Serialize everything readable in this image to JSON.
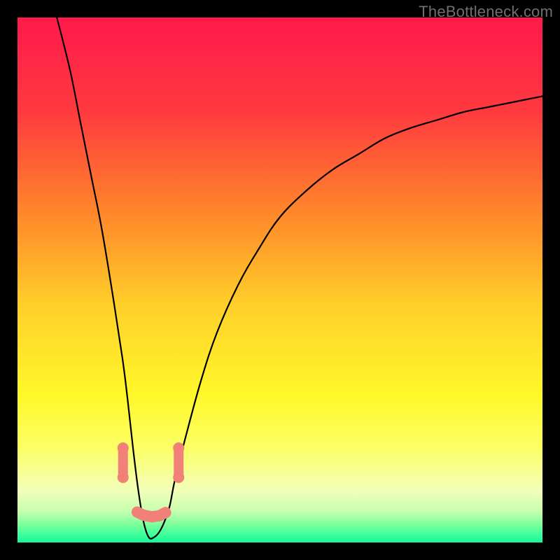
{
  "watermark": "TheBottleneck.com",
  "chart_data": {
    "type": "line",
    "title": "",
    "xlabel": "",
    "ylabel": "",
    "xlim": [
      0,
      100
    ],
    "ylim": [
      0,
      100
    ],
    "grid": false,
    "legend": false,
    "optimum_x": 25,
    "background_gradient": {
      "stops": [
        {
          "offset": 0.0,
          "color": "#ff1a4b"
        },
        {
          "offset": 0.18,
          "color": "#ff3a3f"
        },
        {
          "offset": 0.38,
          "color": "#ff8a2a"
        },
        {
          "offset": 0.55,
          "color": "#ffd02a"
        },
        {
          "offset": 0.72,
          "color": "#fff82a"
        },
        {
          "offset": 0.82,
          "color": "#fcff66"
        },
        {
          "offset": 0.9,
          "color": "#f2ffb8"
        },
        {
          "offset": 0.94,
          "color": "#c8ffb0"
        },
        {
          "offset": 0.965,
          "color": "#7fff9c"
        },
        {
          "offset": 0.985,
          "color": "#3dff9c"
        },
        {
          "offset": 1.0,
          "color": "#18f59c"
        }
      ]
    },
    "series": [
      {
        "name": "bottleneck-curve",
        "color": "#000000",
        "x": [
          7.5,
          10,
          12,
          14,
          16,
          18,
          20,
          21,
          22,
          23,
          24,
          25,
          26,
          27,
          28,
          29,
          30,
          32,
          35,
          38,
          42,
          46,
          50,
          55,
          60,
          65,
          70,
          75,
          80,
          85,
          90,
          95,
          100
        ],
        "values": [
          100,
          90,
          80,
          70,
          60,
          48,
          35,
          27,
          18,
          10,
          4,
          1,
          1,
          2,
          4,
          7,
          12,
          20,
          31,
          40,
          49,
          56,
          62,
          67,
          71,
          74,
          77,
          79,
          80.5,
          82,
          83,
          84,
          85
        ]
      }
    ],
    "markers": [
      {
        "name": "marker-left-upper",
        "x": 20.1,
        "y": 18.0,
        "color": "#f08078"
      },
      {
        "name": "marker-left-lower",
        "x": 20.1,
        "y": 12.4,
        "color": "#f08078"
      },
      {
        "name": "marker-right-upper",
        "x": 30.7,
        "y": 18.0,
        "color": "#f08078"
      },
      {
        "name": "marker-right-lower",
        "x": 30.7,
        "y": 12.4,
        "color": "#f08078"
      },
      {
        "name": "marker-bend-1",
        "x": 22.8,
        "y": 5.8,
        "color": "#f08078"
      },
      {
        "name": "marker-bend-2",
        "x": 24.0,
        "y": 5.2,
        "color": "#f08078"
      },
      {
        "name": "marker-bend-3",
        "x": 25.6,
        "y": 4.9,
        "color": "#f08078"
      },
      {
        "name": "marker-bend-4",
        "x": 27.0,
        "y": 5.1,
        "color": "#f08078"
      },
      {
        "name": "marker-bend-5",
        "x": 28.2,
        "y": 5.7,
        "color": "#f08078"
      }
    ]
  }
}
